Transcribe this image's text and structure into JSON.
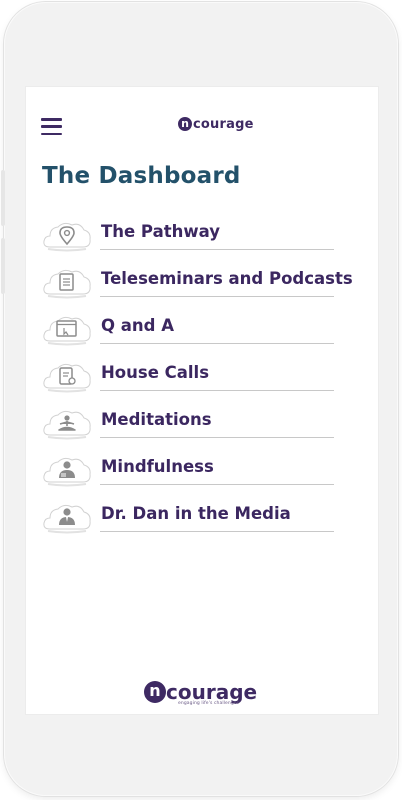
{
  "header": {
    "menu_icon": "hamburger-icon",
    "logo_letter": "n",
    "logo_text": "courage"
  },
  "page": {
    "title": "The Dashboard"
  },
  "menu": {
    "items": [
      {
        "label": "The Pathway",
        "icon": "map-pin-icon"
      },
      {
        "label": "Teleseminars and Podcasts",
        "icon": "document-icon"
      },
      {
        "label": "Q and A",
        "icon": "browser-window-icon"
      },
      {
        "label": "House Calls",
        "icon": "clipboard-icon"
      },
      {
        "label": "Meditations",
        "icon": "meditation-icon"
      },
      {
        "label": "Mindfulness",
        "icon": "person-icon"
      },
      {
        "label": "Dr. Dan in the Media",
        "icon": "presenter-icon"
      }
    ]
  },
  "footer": {
    "logo_letter": "n",
    "logo_text": "courage",
    "tagline": "engaging life's challenges"
  },
  "colors": {
    "brand_purple": "#3e2a63",
    "title_teal": "#23516a",
    "item_text": "#3b2760",
    "icon_gray": "#8c8c8c"
  }
}
